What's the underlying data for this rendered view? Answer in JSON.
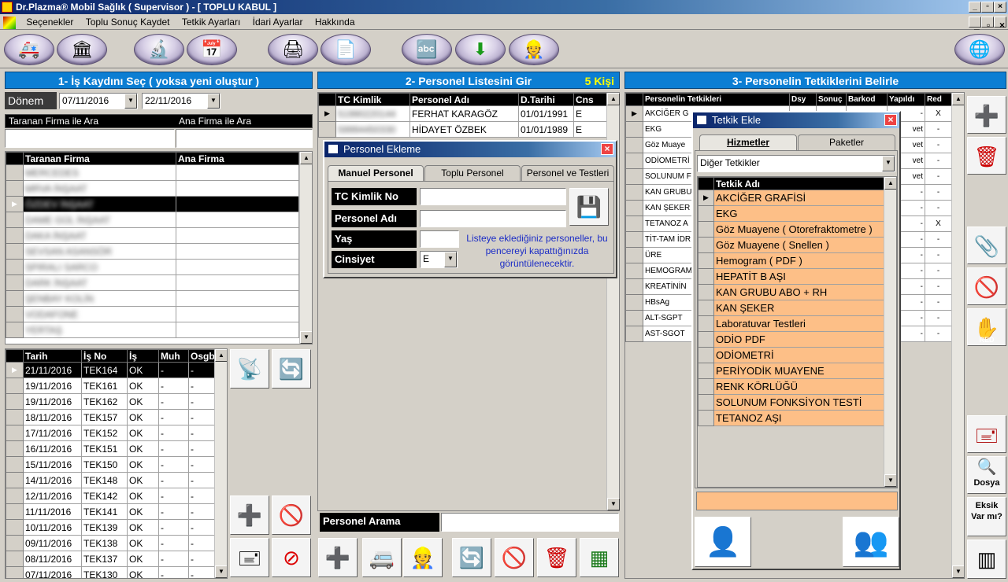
{
  "window": {
    "title": "Dr.Plazma® Mobil Sağlık ( Supervisor ) - [ TOPLU KABUL ]"
  },
  "menu": [
    "Seçenekler",
    "Toplu Sonuç Kaydet",
    "Tetkik Ayarları",
    "İdari Ayarlar",
    "Hakkında"
  ],
  "panel1": {
    "header": "1- İş Kaydını Seç ( yoksa yeni oluştur )",
    "donem_label": "Dönem",
    "date_from": "07/11/2016",
    "date_to": "22/11/2016",
    "search_firma_label": "Taranan Firma ile Ara",
    "search_ana_label": "Ana Firma ile Ara",
    "firma_cols": [
      "Taranan Firma",
      "Ana Firma"
    ],
    "firma_rows": [
      "MERCEDES",
      "MRVA İNŞAAT",
      "ÖZDEV İNŞAAT",
      "DAME GÜL İNŞAAT",
      "DAKA İNŞAAT",
      "SEVSAN ASANSÖR",
      "SPIRALI SARCO",
      "DARK İNŞAAT",
      "ŞENBAY KOLİN",
      "VODAFONE",
      "YERTAŞ"
    ],
    "firma_selected": 2,
    "is_cols": [
      "Tarih",
      "İş No",
      "İş",
      "Muh",
      "Osgb"
    ],
    "is_rows": [
      [
        "21/11/2016",
        "TEK164",
        "OK",
        "-",
        "-"
      ],
      [
        "19/11/2016",
        "TEK161",
        "OK",
        "-",
        "-"
      ],
      [
        "19/11/2016",
        "TEK162",
        "OK",
        "-",
        "-"
      ],
      [
        "18/11/2016",
        "TEK157",
        "OK",
        "-",
        "-"
      ],
      [
        "17/11/2016",
        "TEK152",
        "OK",
        "-",
        "-"
      ],
      [
        "16/11/2016",
        "TEK151",
        "OK",
        "-",
        "-"
      ],
      [
        "15/11/2016",
        "TEK150",
        "OK",
        "-",
        "-"
      ],
      [
        "14/11/2016",
        "TEK148",
        "OK",
        "-",
        "-"
      ],
      [
        "12/11/2016",
        "TEK142",
        "OK",
        "-",
        "-"
      ],
      [
        "11/11/2016",
        "TEK141",
        "OK",
        "-",
        "-"
      ],
      [
        "10/11/2016",
        "TEK139",
        "OK",
        "-",
        "-"
      ],
      [
        "09/11/2016",
        "TEK138",
        "OK",
        "-",
        "-"
      ],
      [
        "08/11/2016",
        "TEK137",
        "OK",
        "-",
        "-"
      ],
      [
        "07/11/2016",
        "TEK130",
        "OK",
        "-",
        "-"
      ]
    ]
  },
  "panel2": {
    "header": "2- Personel Listesini Gir",
    "count": "5 Kişi",
    "cols": [
      "TC Kimlik",
      "Personel Adı",
      "D.Tarihi",
      "Cns"
    ],
    "rows": [
      [
        "51990220144",
        "FERHAT KARAGÖZ",
        "01/01/1991",
        "E"
      ],
      [
        "59994450330",
        "HİDAYET ÖZBEK",
        "01/01/1989",
        "E"
      ]
    ],
    "search_label": "Personel Arama"
  },
  "personel_dialog": {
    "title": "Personel Ekleme",
    "tabs": [
      "Manuel Personel",
      "Toplu Personel",
      "Personel ve Testleri"
    ],
    "fields": [
      "TC Kimlik No",
      "Personel Adı",
      "Yaş",
      "Cinsiyet"
    ],
    "gender_value": "E",
    "note": "Listeye eklediğiniz personeller, bu pencereyi kapattığınızda görüntülenecektir."
  },
  "panel3": {
    "header": "3- Personelin Tetkiklerini Belirle",
    "cols": [
      "Personelin Tetkikleri",
      "Dsy",
      "Sonuç",
      "Barkod",
      "Yapıldı",
      "Red"
    ],
    "rows": [
      [
        "AKCİĞER G",
        "-",
        "X"
      ],
      [
        "EKG",
        "vet",
        "-"
      ],
      [
        "Göz Muaye",
        "vet",
        "-"
      ],
      [
        "ODİOMETRİ",
        "vet",
        "-"
      ],
      [
        "SOLUNUM F",
        "vet",
        "-"
      ],
      [
        "KAN GRUBU",
        "-",
        "-"
      ],
      [
        "KAN ŞEKER",
        "-",
        "-"
      ],
      [
        "TETANOZ A",
        "-",
        "X"
      ],
      [
        "TİT-TAM İDR",
        "-",
        "-"
      ],
      [
        "ÜRE",
        "-",
        "-"
      ],
      [
        "HEMOGRAM",
        "-",
        "-"
      ],
      [
        "KREATİNİN",
        "-",
        "-"
      ],
      [
        "HBsAg",
        "-",
        "-"
      ],
      [
        "ALT-SGPT",
        "-",
        "-"
      ],
      [
        "AST-SGOT",
        "-",
        "-"
      ]
    ]
  },
  "tetkik_dialog": {
    "title": "Tetkik Ekle",
    "tabs": [
      "Hizmetler",
      "Paketler"
    ],
    "category": "Diğer Tetkikler",
    "col": "Tetkik Adı",
    "items": [
      "AKCİĞER GRAFİSİ",
      "EKG",
      "Göz Muayene ( Otorefraktometre )",
      "Göz Muayene ( Snellen )",
      "Hemogram ( PDF )",
      "HEPATİT B AŞI",
      "KAN GRUBU ABO + RH",
      "KAN ŞEKER",
      "Laboratuvar Testleri",
      "ODİO PDF",
      "ODİOMETRİ",
      "PERİYODİK MUAYENE",
      "RENK KÖRLÜĞÜ",
      "SOLUNUM FONKSİYON TESTİ",
      "TETANOZ AŞI"
    ]
  },
  "right_buttons": {
    "red_label": "RED",
    "dosya_label": "Dosya",
    "eksik_label": "Eksik Var mı?"
  },
  "colors": {
    "panel_header": "#0c7ed3",
    "tetkik_row": "#fdbf87",
    "count_text": "#ffff00"
  }
}
